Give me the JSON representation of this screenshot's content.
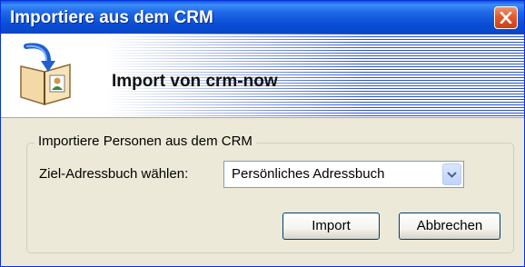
{
  "window": {
    "title": "Importiere aus dem CRM",
    "close_icon": "close-icon"
  },
  "banner": {
    "icon": "address-book-import-icon",
    "title": "Import von crm-now"
  },
  "group": {
    "legend": "Importiere Personen aus dem CRM",
    "field_label": "Ziel-Adressbuch wählen:",
    "select": {
      "value": "Persönliches Adressbuch",
      "icon": "chevron-down-icon"
    }
  },
  "buttons": {
    "import_label": "Import",
    "cancel_label": "Abbrechen"
  },
  "colors": {
    "titlebar": "#0a4fd6",
    "dialog_bg": "#ece9d8",
    "close_button": "#e35a2a"
  }
}
